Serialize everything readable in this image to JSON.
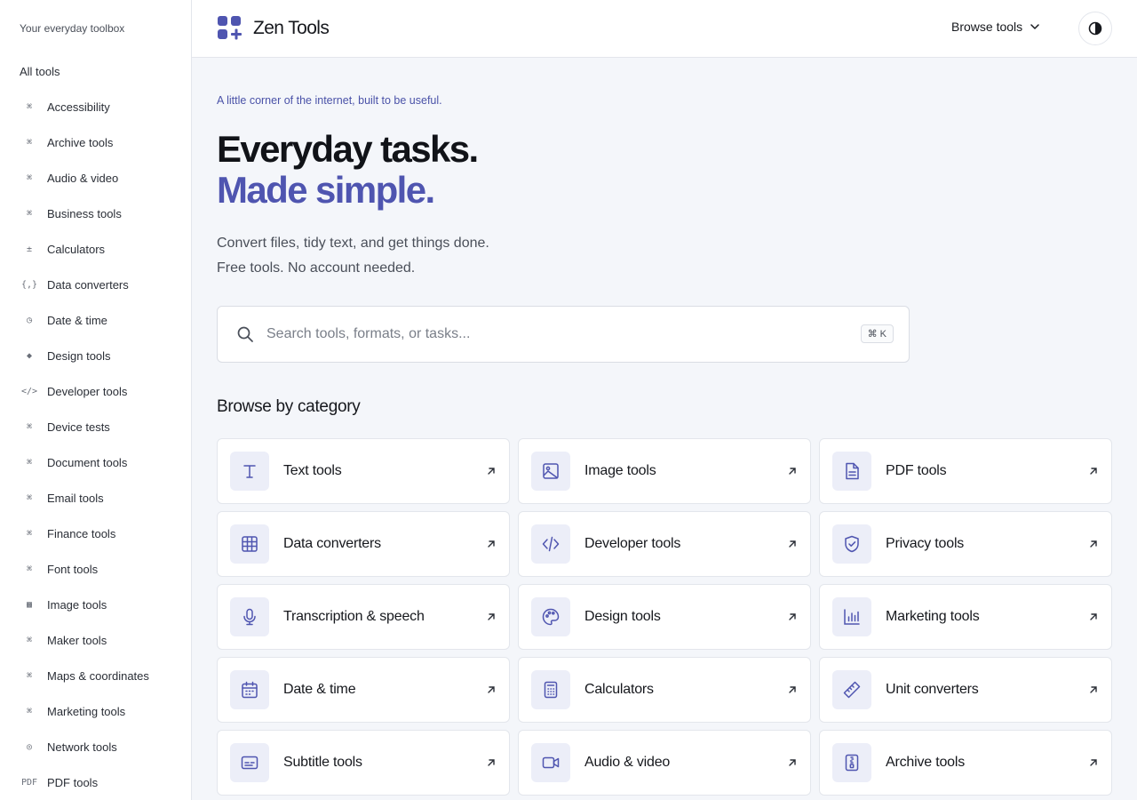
{
  "sidebar": {
    "tagline": "Your everyday toolbox",
    "all_tools": "All tools",
    "items": [
      {
        "icon": "⌘",
        "label": "Accessibility"
      },
      {
        "icon": "⌘",
        "label": "Archive tools"
      },
      {
        "icon": "⌘",
        "label": "Audio & video"
      },
      {
        "icon": "⌘",
        "label": "Business tools"
      },
      {
        "icon": "±",
        "label": "Calculators"
      },
      {
        "icon": "{,}",
        "label": "Data converters"
      },
      {
        "icon": "◷",
        "label": "Date & time"
      },
      {
        "icon": "◆",
        "label": "Design tools"
      },
      {
        "icon": "</>",
        "label": "Developer tools"
      },
      {
        "icon": "⌘",
        "label": "Device tests"
      },
      {
        "icon": "⌘",
        "label": "Document tools"
      },
      {
        "icon": "⌘",
        "label": "Email tools"
      },
      {
        "icon": "⌘",
        "label": "Finance tools"
      },
      {
        "icon": "⌘",
        "label": "Font tools"
      },
      {
        "icon": "▩",
        "label": "Image tools"
      },
      {
        "icon": "⌘",
        "label": "Maker tools"
      },
      {
        "icon": "⌘",
        "label": "Maps & coordinates"
      },
      {
        "icon": "⌘",
        "label": "Marketing tools"
      },
      {
        "icon": "◎",
        "label": "Network tools"
      },
      {
        "icon": "PDF",
        "label": "PDF tools"
      }
    ]
  },
  "header": {
    "brand": "Zen Tools",
    "browse_label": "Browse tools"
  },
  "hero": {
    "eyebrow": "A little corner of the internet, built to be useful.",
    "title_line1": "Everyday tasks.",
    "title_line2": "Made simple.",
    "subtitle_line1": "Convert files, tidy text, and get things done.",
    "subtitle_line2": "Free tools. No account needed."
  },
  "search": {
    "placeholder": "Search tools, formats, or tasks...",
    "value": "",
    "shortcut": "⌘ K"
  },
  "categories": {
    "title": "Browse by category",
    "items": [
      {
        "label": "Text tools",
        "icon": "text-icon"
      },
      {
        "label": "Image tools",
        "icon": "image-icon"
      },
      {
        "label": "PDF tools",
        "icon": "document-icon"
      },
      {
        "label": "Data converters",
        "icon": "table-icon"
      },
      {
        "label": "Developer tools",
        "icon": "code-icon"
      },
      {
        "label": "Privacy tools",
        "icon": "shield-icon"
      },
      {
        "label": "Transcription & speech",
        "icon": "microphone-icon"
      },
      {
        "label": "Design tools",
        "icon": "palette-icon"
      },
      {
        "label": "Marketing tools",
        "icon": "bar-chart-icon"
      },
      {
        "label": "Date & time",
        "icon": "calendar-icon"
      },
      {
        "label": "Calculators",
        "icon": "calculator-icon"
      },
      {
        "label": "Unit converters",
        "icon": "ruler-icon"
      },
      {
        "label": "Subtitle tools",
        "icon": "subtitles-icon"
      },
      {
        "label": "Audio & video",
        "icon": "video-icon"
      },
      {
        "label": "Archive tools",
        "icon": "archive-icon"
      }
    ]
  },
  "colors": {
    "accent": "#4f55b0",
    "icon_tile": "#eceef8",
    "background": "#f4f6fa"
  }
}
